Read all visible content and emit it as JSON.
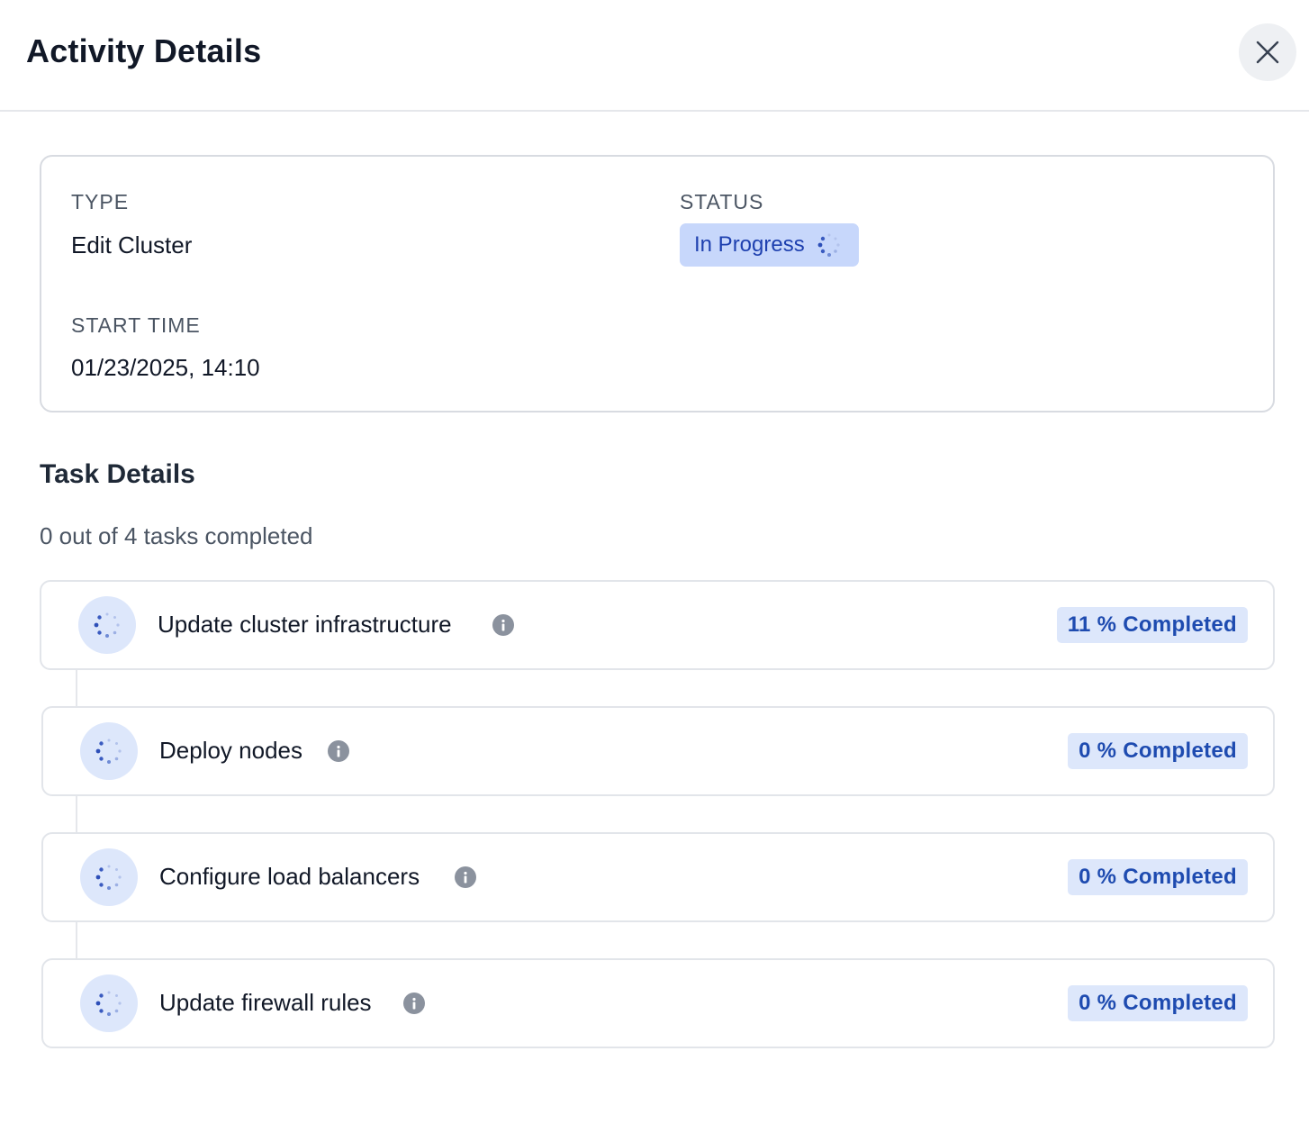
{
  "header": {
    "title": "Activity Details",
    "close_icon": "close-icon"
  },
  "summary": {
    "type_label": "TYPE",
    "type_value": "Edit Cluster",
    "status_label": "STATUS",
    "status_value": "In Progress",
    "start_time_label": "START TIME",
    "start_time_value": "01/23/2025, 14:10"
  },
  "task_details": {
    "title": "Task Details",
    "count_text": "0 out of 4 tasks completed",
    "tasks": [
      {
        "name": "Update cluster infrastructure",
        "progress_text": "11 % Completed",
        "progress_percent": 11,
        "icon": "spinner-icon"
      },
      {
        "name": "Deploy nodes",
        "progress_text": "0 % Completed",
        "progress_percent": 0,
        "icon": "spinner-icon"
      },
      {
        "name": "Configure load balancers",
        "progress_text": "0 % Completed",
        "progress_percent": 0,
        "icon": "spinner-icon"
      },
      {
        "name": "Update firewall rules",
        "progress_text": "0 % Completed",
        "progress_percent": 0,
        "icon": "spinner-icon"
      }
    ]
  },
  "colors": {
    "accent": "#1e40af",
    "status_bg": "#c7d7fb",
    "badge_bg": "#dde7fb",
    "info_icon": "#8b929e"
  }
}
